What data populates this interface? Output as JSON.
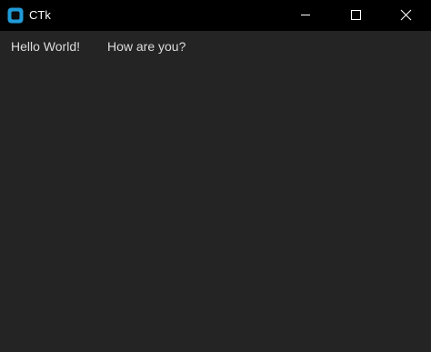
{
  "window": {
    "title": "CTk",
    "icon": "ctk-app-icon",
    "controls": [
      "minimize-icon",
      "maximize-icon",
      "close-icon"
    ]
  },
  "colors": {
    "titlebar": "#000000",
    "background": "#242424",
    "text": "#dcdcdc",
    "icon_accent": "#1f9bd8"
  },
  "labels": {
    "first": "Hello World!",
    "second": "How are you?"
  }
}
